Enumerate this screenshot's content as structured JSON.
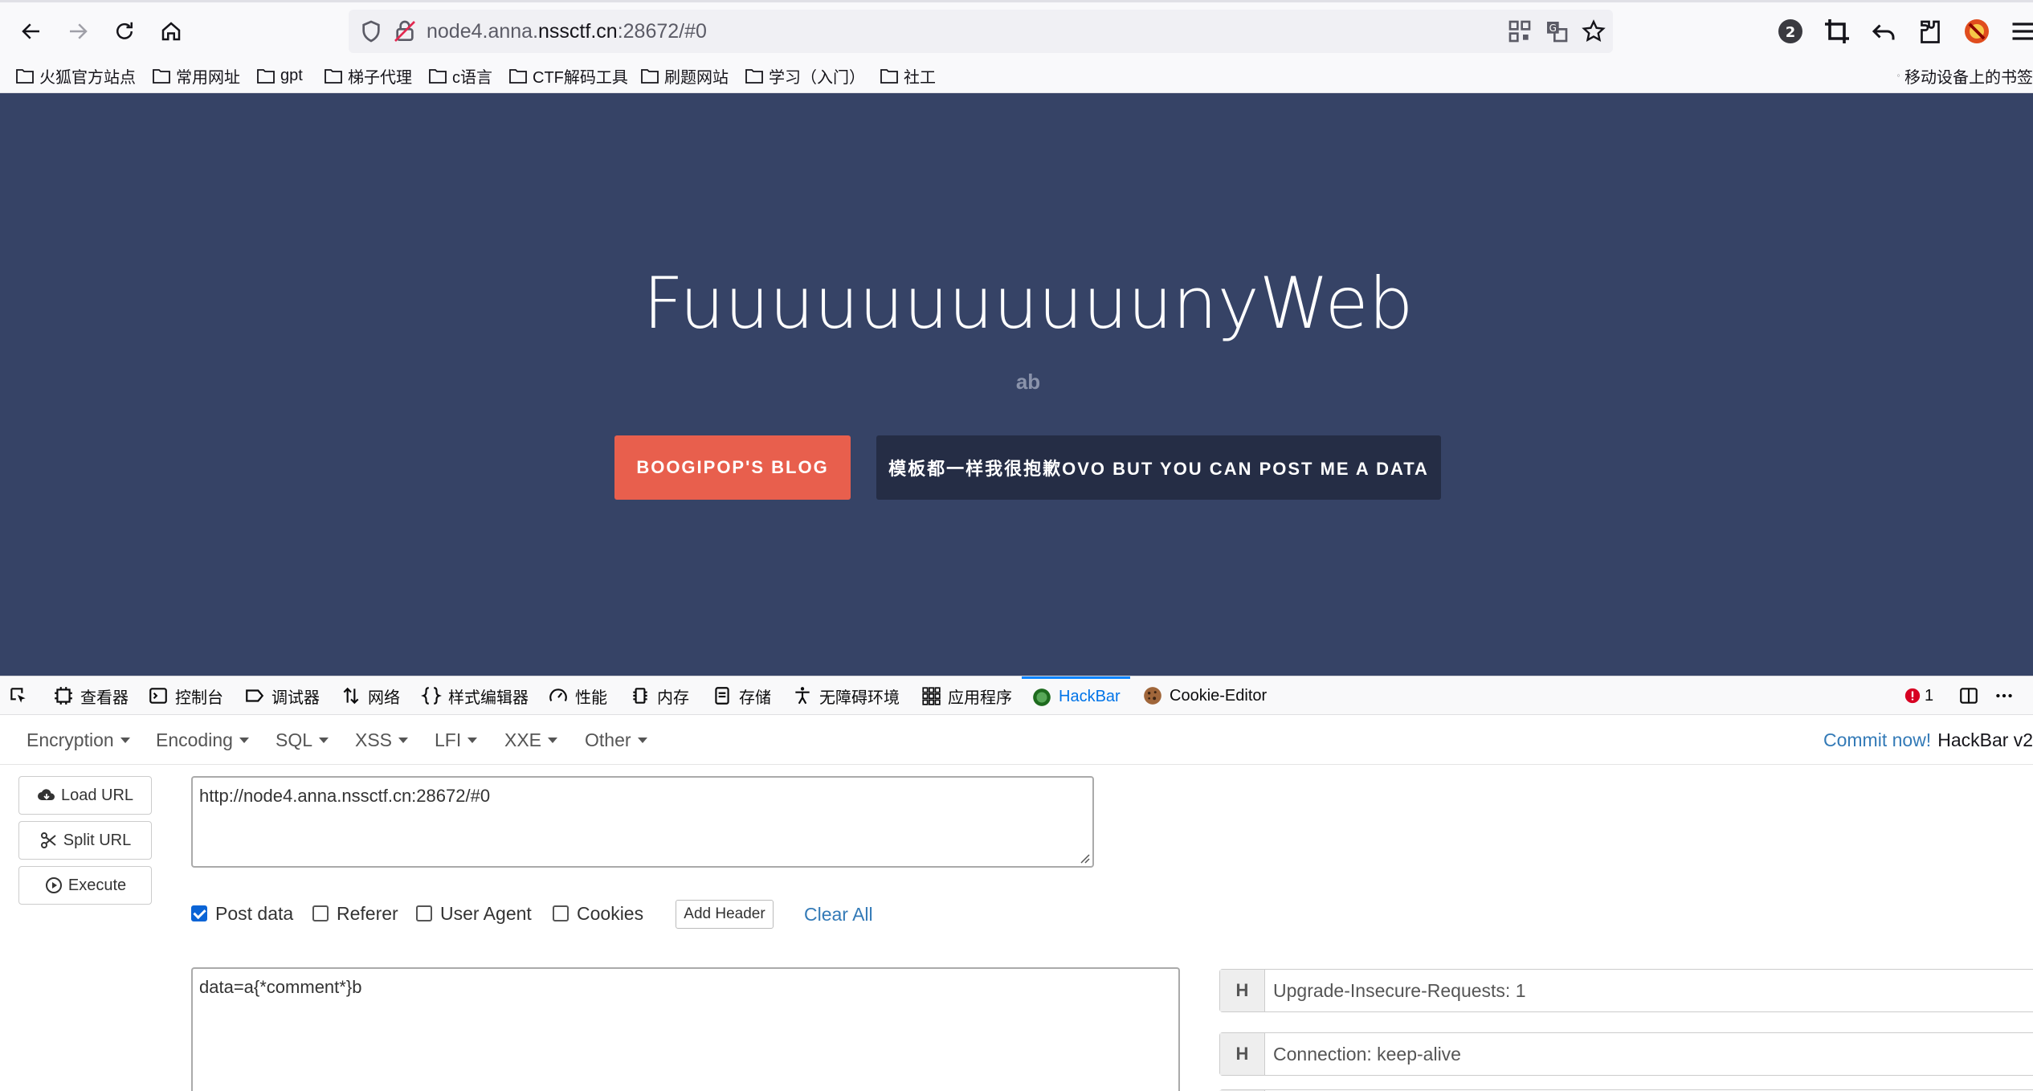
{
  "browser": {
    "url_prefix": "node4.anna.",
    "url_domain": "nssctf.cn",
    "url_suffix": ":28672/#0",
    "notification_count": "2"
  },
  "bookmarks": [
    {
      "label": "火狐官方站点"
    },
    {
      "label": "常用网址"
    },
    {
      "label": "gpt"
    },
    {
      "label": "梯子代理"
    },
    {
      "label": "c语言"
    },
    {
      "label": "CTF解码工具"
    },
    {
      "label": "刷题网站"
    },
    {
      "label": "学习（入门）"
    },
    {
      "label": "社工"
    }
  ],
  "mobile_bookmarks": "移动设备上的书签",
  "page": {
    "title": "FuuuuuuuuuuunyWeb",
    "subtitle": "ab",
    "blog_button": "BOOGIPOP'S BLOG",
    "post_button": "模板都一样我很抱歉OVO BUT YOU CAN POST ME A DATA"
  },
  "devtools": {
    "tabs": [
      {
        "label": "查看器"
      },
      {
        "label": "控制台"
      },
      {
        "label": "调试器"
      },
      {
        "label": "网络"
      },
      {
        "label": "样式编辑器"
      },
      {
        "label": "性能"
      },
      {
        "label": "内存"
      },
      {
        "label": "存储"
      },
      {
        "label": "无障碍环境"
      },
      {
        "label": "应用程序"
      },
      {
        "label": "HackBar"
      },
      {
        "label": "Cookie-Editor"
      }
    ],
    "error_count": "1"
  },
  "hackbar": {
    "menus": [
      "Encryption",
      "Encoding",
      "SQL",
      "XSS",
      "LFI",
      "XXE",
      "Other"
    ],
    "commit_link": "Commit now!",
    "version": "HackBar v2",
    "load_url": "Load URL",
    "split_url": "Split URL",
    "execute": "Execute",
    "url_value": "http://node4.anna.nssctf.cn:28672/#0",
    "options": [
      {
        "label": "Post data",
        "checked": true
      },
      {
        "label": "Referer",
        "checked": false
      },
      {
        "label": "User Agent",
        "checked": false
      },
      {
        "label": "Cookies",
        "checked": false
      }
    ],
    "add_header": "Add Header",
    "clear_all": "Clear All",
    "post_value": "data=a{*comment*}b",
    "header_tag": "H",
    "headers": [
      "Upgrade-Insecure-Requests: 1",
      "Connection: keep-alive"
    ]
  }
}
